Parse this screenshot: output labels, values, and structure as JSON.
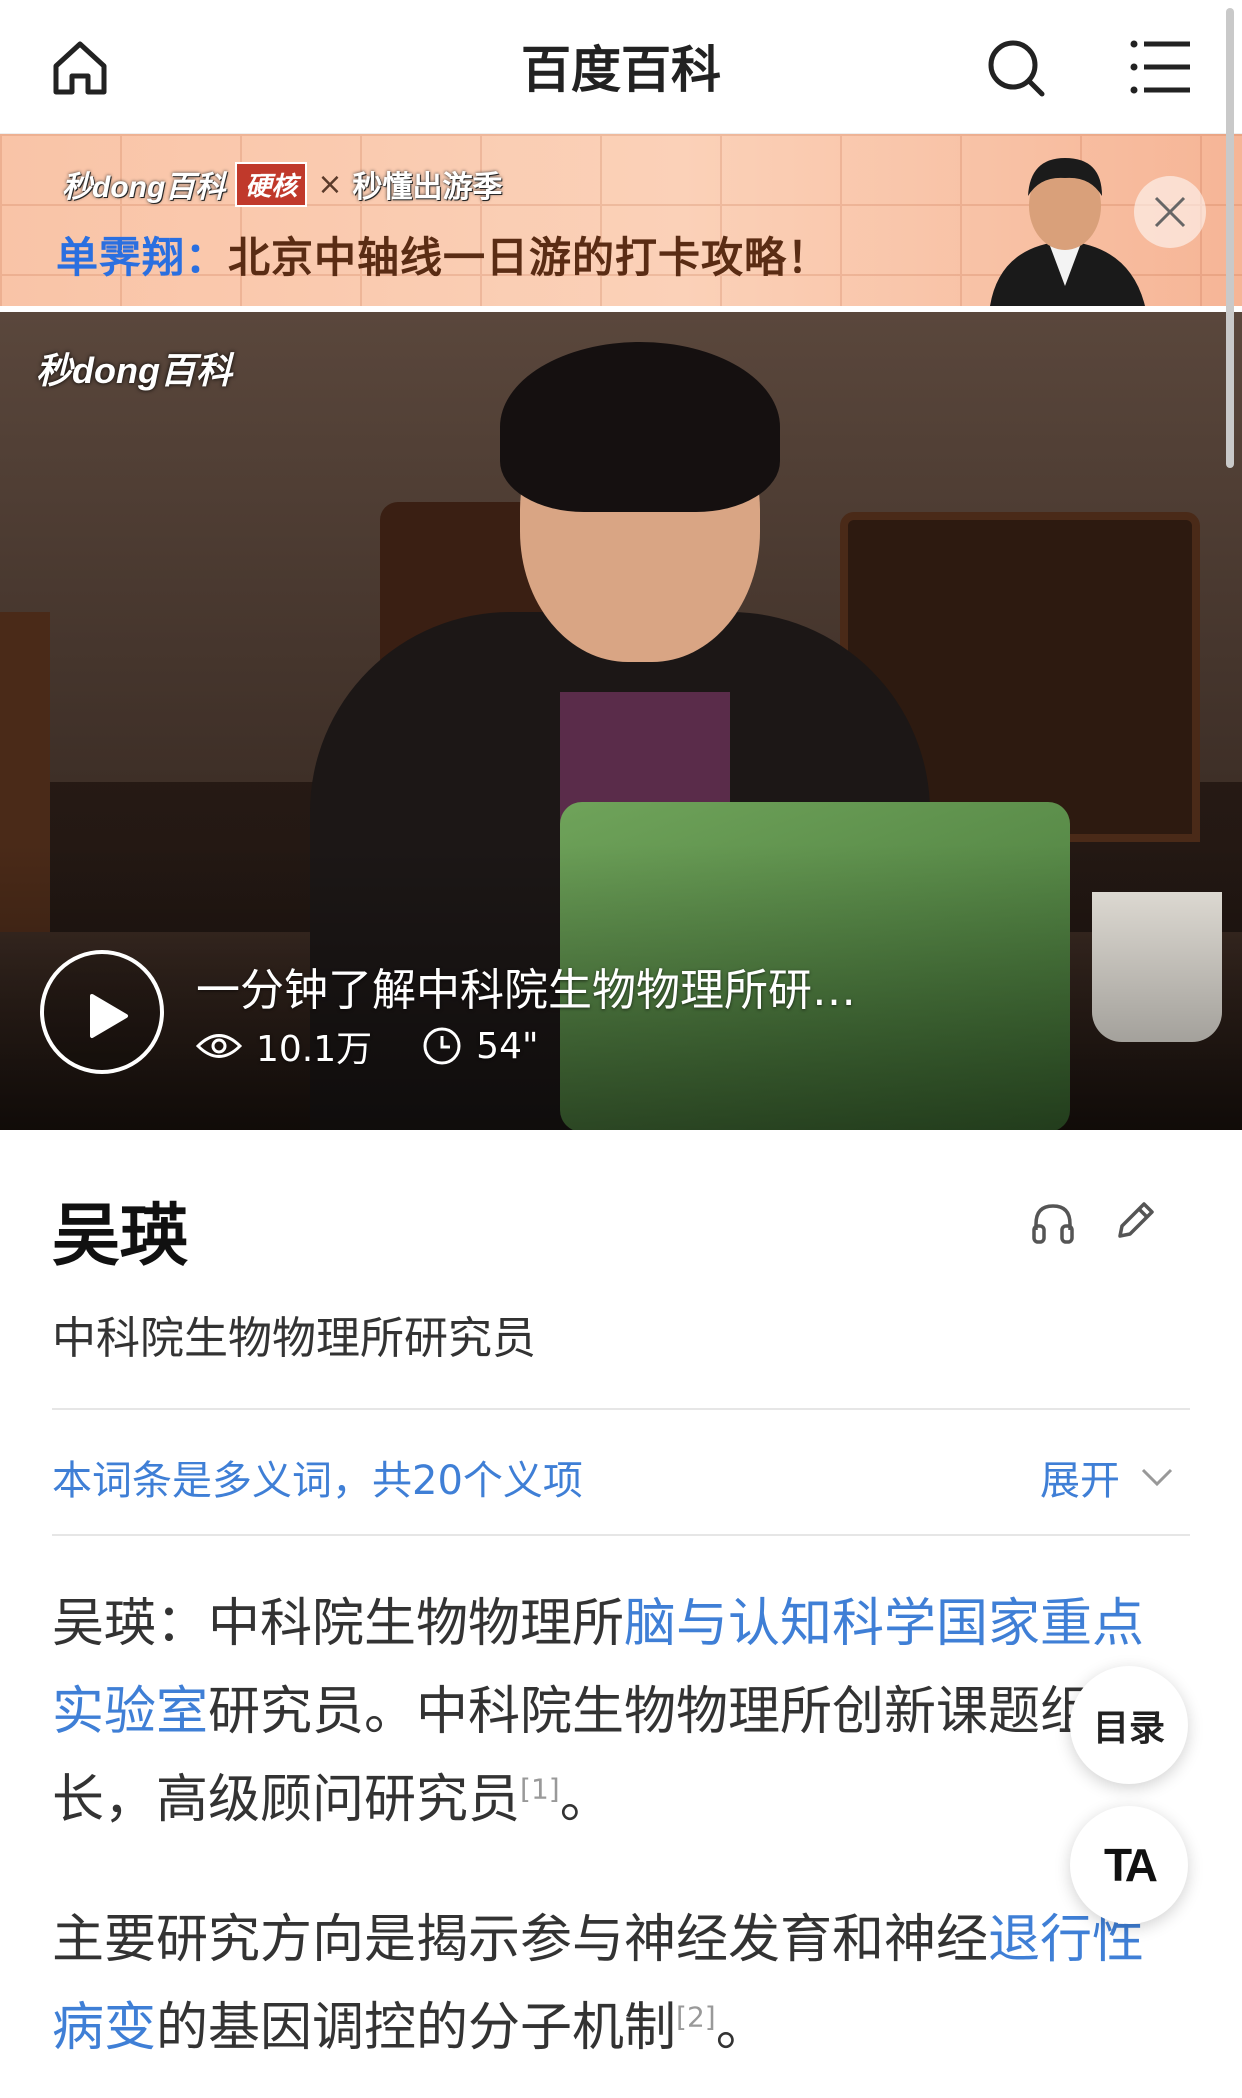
{
  "nav": {
    "title": "百度百科"
  },
  "banner": {
    "brand": "秒dong百科",
    "hard_tag": "硬核",
    "times": "×",
    "season": "秒懂出游季",
    "headline_name": "单霁翔：",
    "headline_rest": "北京中轴线一日游的打卡攻略！"
  },
  "video": {
    "brand": "秒dong百科",
    "title": "一分钟了解中科院生物物理所研…",
    "views": "10.1万",
    "duration": "54\""
  },
  "entry": {
    "title": "吴瑛",
    "subtitle": "中科院生物物理所研究员",
    "polysemy": "本词条是多义词，共20个义项",
    "expand": "展开"
  },
  "para1": {
    "t1": "吴瑛：中科院生物物理所",
    "link1": "脑与认知科学国家重点实验室",
    "t2": "研究员。中科院生物物理所创新课题组组长，高级顾问研究员",
    "ref1": "[1]",
    "t3": "。"
  },
  "para2": {
    "t1": "主要研究方向是揭示参与神经发育和神经",
    "link1": "退行性病变",
    "t2": "的基因调控的分子机制",
    "ref1": "[2]",
    "t3": "。"
  },
  "fab": {
    "toc": "目录",
    "font": "TA"
  },
  "icons": [
    "home-icon",
    "search-icon",
    "menu-icon",
    "close-icon",
    "play-icon",
    "eye-icon",
    "clock-icon",
    "headphones-icon",
    "pencil-icon",
    "chevron-down-icon"
  ]
}
